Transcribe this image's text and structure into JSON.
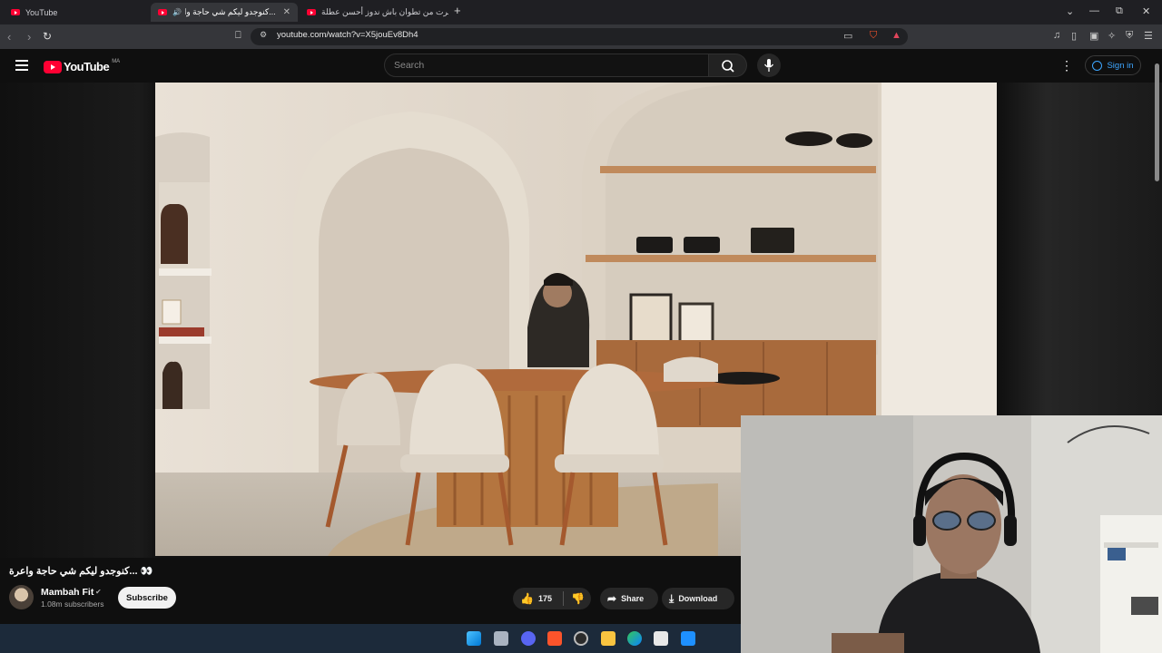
{
  "browser": {
    "tabs": [
      {
        "title": "YouTube"
      },
      {
        "title": "...كنوجدو ليكم شي حاجة واعرة",
        "close": "✕"
      },
      {
        "title": "سافرت من تطوان باش ندوز أحسن عطلة"
      }
    ],
    "new_tab": "+",
    "url": "youtube.com/watch?v=X5jouEv8Dh4"
  },
  "youtube": {
    "logo_text": "YouTube",
    "country_code": "MA",
    "search_placeholder": "Search",
    "sign_in": "Sign in"
  },
  "video": {
    "title": "👀 ...كنوجدو ليكم شي حاجة واعرة",
    "channel": "Mambah Fit",
    "subscribers": "1.08m subscribers",
    "subscribe_label": "Subscribe",
    "likes": "175",
    "share_label": "Share",
    "download_label": "Download"
  },
  "colors": {
    "youtube_red": "#ff0033",
    "link_blue": "#3ea6ff",
    "background": "#0f0f0f"
  }
}
